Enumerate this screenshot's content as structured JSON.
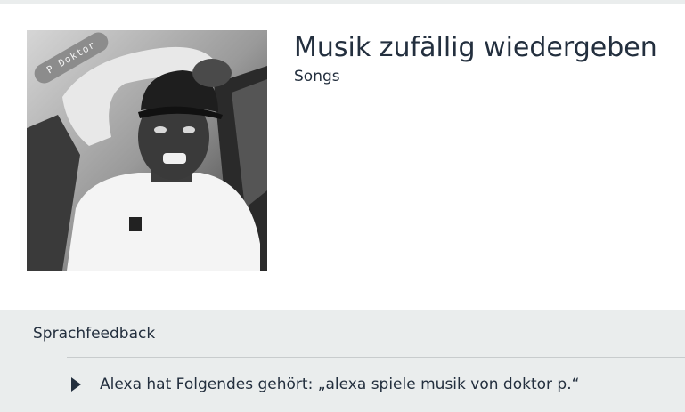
{
  "media": {
    "title": "Musik zufällig wiedergeben",
    "subtitle": "Songs",
    "cover_badge": "P Doktor"
  },
  "feedback": {
    "header": "Sprachfeedback",
    "heard_text": "Alexa hat Folgendes gehört: „alexa spiele musik von doktor p.“",
    "expand_icon": "triangle-right-icon"
  },
  "colors": {
    "text": "#232f3e",
    "panel_bg": "#eaeded",
    "card_bg": "#ffffff",
    "divider": "#c8cccd"
  }
}
